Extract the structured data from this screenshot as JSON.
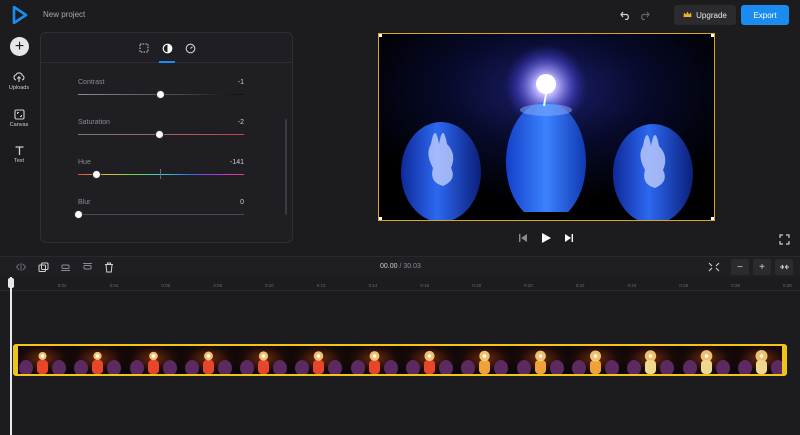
{
  "header": {
    "project_title": "New project",
    "upgrade_label": "Upgrade",
    "export_label": "Export"
  },
  "leftnav": {
    "items": [
      {
        "label": "Uploads",
        "icon": "upload-icon"
      },
      {
        "label": "Canvas",
        "icon": "canvas-icon"
      },
      {
        "label": "Text",
        "icon": "text-icon"
      }
    ]
  },
  "adjust_panel": {
    "tabs": [
      "crop-icon",
      "adjust-icon",
      "speed-icon"
    ],
    "active_tab": "adjust-icon",
    "contrast": {
      "label": "Contrast",
      "value": "-1",
      "position": 0.495
    },
    "saturation": {
      "label": "Saturation",
      "value": "-2",
      "position": 0.49
    },
    "hue": {
      "label": "Hue",
      "value": "-141",
      "position": 0.11
    },
    "blur": {
      "label": "Blur",
      "value": "0",
      "position": 0.0
    }
  },
  "timeline": {
    "current_time": "00.00",
    "separator": "/",
    "total_time": "30.03",
    "ruler_ticks": [
      "0",
      "0:02",
      "0:04",
      "0:06",
      "0:08",
      "0:10",
      "0:12",
      "0:14",
      "0:16",
      "0:18",
      "0:20",
      "0:22",
      "0:24",
      "0:26",
      "0:28",
      "0:30"
    ],
    "zoom_out_label": "−",
    "zoom_in_label": "+"
  },
  "colors": {
    "accent": "#1a8cf0",
    "selection": "#f0c419",
    "preview_border": "#d4a62a"
  }
}
